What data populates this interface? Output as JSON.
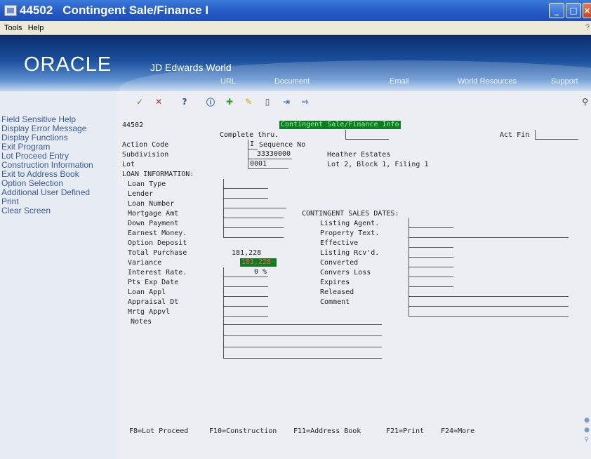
{
  "window": {
    "number": "44502",
    "title": "Contingent Sale/Finance I"
  },
  "menu": [
    "Tools",
    "Help"
  ],
  "banner": {
    "logo_text": "ORACLE",
    "product": "JD Edwards World",
    "links": [
      "URL",
      "Document",
      "Email",
      "World Resources",
      "Support"
    ]
  },
  "left_menu": [
    "Field Sensitive Help",
    "Display Error Message",
    "Display Functions",
    "Exit Program",
    "Lot Proceed Entry",
    "Construction Information",
    "Exit to Address Book",
    "Option Selection",
    "Additional User Defined",
    "Print",
    "Clear Screen"
  ],
  "screen": {
    "program_id": "44502",
    "heading": "Contingent Sale/Finance Info",
    "complete_thru_label": "Complete thru.",
    "act_fin_label": "Act Fin",
    "action_code_label": "Action Code",
    "action_code_value": "I",
    "sequence_label": "Sequence No",
    "subdivision_label": "Subdivision",
    "subdivision_value": "33330000",
    "subdivision_name": "Heather Estates",
    "lot_label": "Lot",
    "lot_value": "0001",
    "lot_desc": "Lot 2, Block 1, Filing 1",
    "loan_info_label": "LOAN INFORMATION:",
    "loan_labels": {
      "loan_type": "Loan Type",
      "lender": "Lender",
      "loan_number": "Loan Number",
      "mortgage_amt": "Mortgage Amt",
      "down_payment": "Down Payment",
      "earnest_money": "Earnest Money.",
      "option_deposit": "Option Deposit",
      "total_purchase": "Total Purchase",
      "variance": "Variance",
      "interest_rate": "Interest Rate.",
      "pts_exp_date": "Pts Exp Date",
      "loan_appl": "Loan Appl",
      "appraisal_dt": "Appraisal Dt",
      "mrtg_appvl": "Mrtg Appvl",
      "notes": "Notes"
    },
    "loan_values": {
      "total_purchase": "181,228",
      "variance": "181,228-",
      "interest_rate": "0 %"
    },
    "contingent_label": "CONTINGENT SALES DATES:",
    "contingent_labels": {
      "listing_agent": "Listing Agent.",
      "property_text": "Property Text.",
      "effective": "Effective",
      "listing_rcvd": "Listing Rcv'd.",
      "converted": "Converted",
      "convers_loss": "Convers Loss",
      "expires": "Expires",
      "released": "Released",
      "comment": "Comment"
    },
    "function_keys": [
      "F8=Lot Proceed",
      "F10=Construction",
      "F11=Address Book",
      "F21=Print",
      "F24=More"
    ]
  },
  "colors": {
    "highlight_bg": "#0c7d20",
    "highlight_text": "#9ef2a8",
    "left_menu_text": "#3a5c9a"
  }
}
